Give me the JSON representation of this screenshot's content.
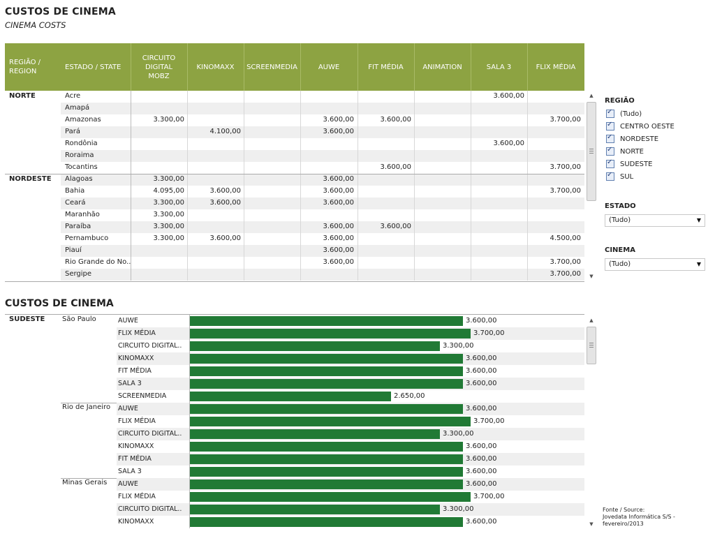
{
  "header": {
    "title": "CUSTOS DE CINEMA",
    "subtitle": "CINEMA COSTS"
  },
  "table": {
    "columns": [
      "REGIÃO /\nREGION",
      "ESTADO / STATE",
      "CIRCUITO\nDIGITAL\nMOBZ",
      "KINOMAXX",
      "SCREENMEDIA",
      "AUWE",
      "FIT MÉDIA",
      "ANIMATION",
      "SALA 3",
      "FLIX MÉDIA"
    ],
    "rows": [
      {
        "region": "NORTE",
        "state": "Acre",
        "values": [
          "",
          "",
          "",
          "",
          "",
          "",
          "3.600,00",
          ""
        ]
      },
      {
        "region": "",
        "state": "Amapá",
        "values": [
          "",
          "",
          "",
          "",
          "",
          "",
          "",
          ""
        ]
      },
      {
        "region": "",
        "state": "Amazonas",
        "values": [
          "3.300,00",
          "",
          "",
          "3.600,00",
          "3.600,00",
          "",
          "",
          "3.700,00"
        ]
      },
      {
        "region": "",
        "state": "Pará",
        "values": [
          "",
          "4.100,00",
          "",
          "3.600,00",
          "",
          "",
          "",
          ""
        ]
      },
      {
        "region": "",
        "state": "Rondônia",
        "values": [
          "",
          "",
          "",
          "",
          "",
          "",
          "3.600,00",
          ""
        ]
      },
      {
        "region": "",
        "state": "Roraima",
        "values": [
          "",
          "",
          "",
          "",
          "",
          "",
          "",
          ""
        ]
      },
      {
        "region": "",
        "state": "Tocantins",
        "values": [
          "",
          "",
          "",
          "",
          "3.600,00",
          "",
          "",
          "3.700,00"
        ]
      },
      {
        "region": "NORDESTE",
        "state": "Alagoas",
        "values": [
          "3.300,00",
          "",
          "",
          "3.600,00",
          "",
          "",
          "",
          ""
        ]
      },
      {
        "region": "",
        "state": "Bahia",
        "values": [
          "4.095,00",
          "3.600,00",
          "",
          "3.600,00",
          "",
          "",
          "",
          "3.700,00"
        ]
      },
      {
        "region": "",
        "state": "Ceará",
        "values": [
          "3.300,00",
          "3.600,00",
          "",
          "3.600,00",
          "",
          "",
          "",
          ""
        ]
      },
      {
        "region": "",
        "state": "Maranhão",
        "values": [
          "3.300,00",
          "",
          "",
          "",
          "",
          "",
          "",
          ""
        ]
      },
      {
        "region": "",
        "state": "Paraíba",
        "values": [
          "3.300,00",
          "",
          "",
          "3.600,00",
          "3.600,00",
          "",
          "",
          ""
        ]
      },
      {
        "region": "",
        "state": "Pernambuco",
        "values": [
          "3.300,00",
          "3.600,00",
          "",
          "3.600,00",
          "",
          "",
          "",
          "4.500,00"
        ]
      },
      {
        "region": "",
        "state": "Piauí",
        "values": [
          "",
          "",
          "",
          "3.600,00",
          "",
          "",
          "",
          ""
        ]
      },
      {
        "region": "",
        "state": "Rio Grande do No..",
        "values": [
          "",
          "",
          "",
          "3.600,00",
          "",
          "",
          "",
          "3.700,00"
        ]
      },
      {
        "region": "",
        "state": "Sergipe",
        "values": [
          "",
          "",
          "",
          "",
          "",
          "",
          "",
          "3.700,00"
        ]
      }
    ]
  },
  "filters": {
    "regiao_label": "REGIÃO",
    "regiao_options": [
      "(Tudo)",
      "CENTRO OESTE",
      "NORDESTE",
      "NORTE",
      "SUDESTE",
      "SUL"
    ],
    "estado_label": "ESTADO",
    "estado_value": "(Tudo)",
    "cinema_label": "CINEMA",
    "cinema_value": "(Tudo)"
  },
  "source": {
    "line1": "Fonte / Source:",
    "line2": "Jovedata Informática S/S -",
    "line3": "fevereiro/2013"
  },
  "chart_section_title": "CUSTOS DE CINEMA",
  "chart_data": {
    "type": "bar",
    "orientation": "horizontal",
    "title": "CUSTOS DE CINEMA",
    "xlim": [
      0,
      4500
    ],
    "bar_color": "#217a35",
    "groups": [
      {
        "region": "SUDESTE",
        "state": "São Paulo",
        "bars": [
          {
            "cinema": "AUWE",
            "value": 3600,
            "label": "3.600,00"
          },
          {
            "cinema": "FLIX MÉDIA",
            "value": 3700,
            "label": "3.700,00"
          },
          {
            "cinema": "CIRCUITO DIGITAL..",
            "value": 3300,
            "label": "3.300,00"
          },
          {
            "cinema": "KINOMAXX",
            "value": 3600,
            "label": "3.600,00"
          },
          {
            "cinema": "FIT MÉDIA",
            "value": 3600,
            "label": "3.600,00"
          },
          {
            "cinema": "SALA 3",
            "value": 3600,
            "label": "3.600,00"
          },
          {
            "cinema": "SCREENMEDIA",
            "value": 2650,
            "label": "2.650,00"
          }
        ]
      },
      {
        "region": "",
        "state": "Rio de Janeiro",
        "bars": [
          {
            "cinema": "AUWE",
            "value": 3600,
            "label": "3.600,00"
          },
          {
            "cinema": "FLIX MÉDIA",
            "value": 3700,
            "label": "3.700,00"
          },
          {
            "cinema": "CIRCUITO DIGITAL..",
            "value": 3300,
            "label": "3.300,00"
          },
          {
            "cinema": "KINOMAXX",
            "value": 3600,
            "label": "3.600,00"
          },
          {
            "cinema": "FIT MÉDIA",
            "value": 3600,
            "label": "3.600,00"
          },
          {
            "cinema": "SALA 3",
            "value": 3600,
            "label": "3.600,00"
          }
        ]
      },
      {
        "region": "",
        "state": "Minas Gerais",
        "bars": [
          {
            "cinema": "AUWE",
            "value": 3600,
            "label": "3.600,00"
          },
          {
            "cinema": "FLIX MÉDIA",
            "value": 3700,
            "label": "3.700,00"
          },
          {
            "cinema": "CIRCUITO DIGITAL..",
            "value": 3300,
            "label": "3.300,00"
          },
          {
            "cinema": "KINOMAXX",
            "value": 3600,
            "label": "3.600,00"
          }
        ]
      }
    ]
  }
}
